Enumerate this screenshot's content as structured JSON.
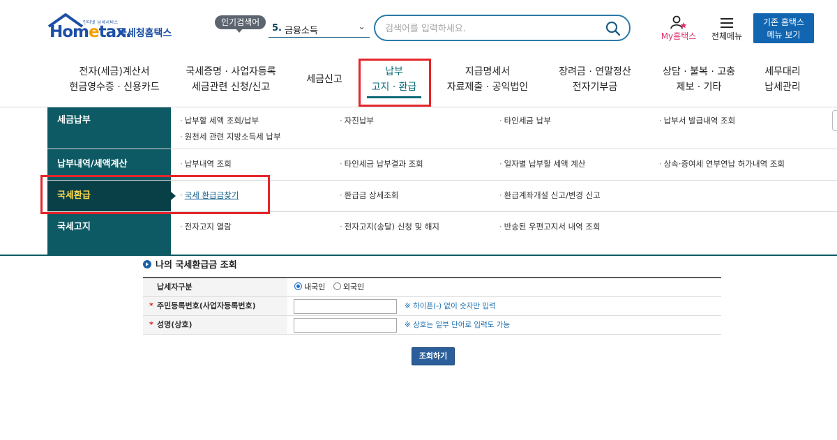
{
  "header": {
    "logo": {
      "slogan": "인터넷 납세서비스",
      "brand_pre": "Hom",
      "brand_e": "e",
      "brand_post": "tax.",
      "name": "국세청홈택스"
    },
    "popular": {
      "tag": "인기검색어",
      "rank": "5.",
      "keyword": "금융소득"
    },
    "search": {
      "placeholder": "검색어를 입력하세요."
    },
    "my_home": "My홈택스",
    "all_menu": "전체메뉴",
    "legacy_line1": "기존 홈택스",
    "legacy_line2": "메뉴 보기"
  },
  "gnb": [
    {
      "line1": "전자(세금)계산서",
      "line2": "현금영수증 · 신용카드"
    },
    {
      "line1": "국세증명 · 사업자등록",
      "line2": "세금관련 신청/신고"
    },
    {
      "line1": "세금신고",
      "line2": ""
    },
    {
      "line1": "납부",
      "line2": "고지 · 환급",
      "active": true
    },
    {
      "line1": "지급명세서",
      "line2": "자료제출 · 공익법인"
    },
    {
      "line1": "장려금 · 연말정산",
      "line2": "전자기부금"
    },
    {
      "line1": "상담 · 불복 · 고충",
      "line2": "제보 · 기타"
    },
    {
      "line1": "세무대리",
      "line2": "납세관리"
    }
  ],
  "mega": {
    "categories": [
      {
        "label": "세금납부",
        "items": [
          "납부할 세액 조회/납부",
          "자진납부",
          "타인세금 납부",
          "납부서 발급내역 조회",
          "원천세 관련 지방소득세 납부"
        ]
      },
      {
        "label": "납부내역/세액계산",
        "items": [
          "납부내역 조회",
          "타인세금 납부결과 조회",
          "일자별 납부할 세액 계산",
          "상속·증여세 연부연납 허가내역 조회"
        ]
      },
      {
        "label": "국세환급",
        "active": true,
        "items": [
          "국세 환급금찾기",
          "환급금 상세조회",
          "환급계좌개설 신고/변경 신고"
        ]
      },
      {
        "label": "국세고지",
        "items": [
          "전자고지 열람",
          "전자고지(송달) 신청 및 해지",
          "반송된 우편고지서 내역 조회"
        ]
      }
    ],
    "bullet": "·"
  },
  "form": {
    "title": "나의 국세환급금 조회",
    "rows": {
      "taxpayer_type": {
        "label": "납세자구분",
        "options": [
          "내국인",
          "외국인"
        ],
        "selected": "내국인"
      },
      "id_number": {
        "label": "주민등록번호(사업자등록번호)",
        "required_mark": "*",
        "value": "",
        "hint": "※ 하이픈(-) 없이 숫자만 입력"
      },
      "name": {
        "label": "성명(상호)",
        "required_mark": "*",
        "value": "",
        "hint": "※ 상호는 일부 단어로 입력도 가능"
      }
    },
    "submit_label": "조회하기"
  },
  "colors": {
    "accent": "#0e5a64",
    "highlight_box": "#e4262b",
    "brand_blue": "#1d4fa6",
    "button_blue": "#1266b1"
  }
}
